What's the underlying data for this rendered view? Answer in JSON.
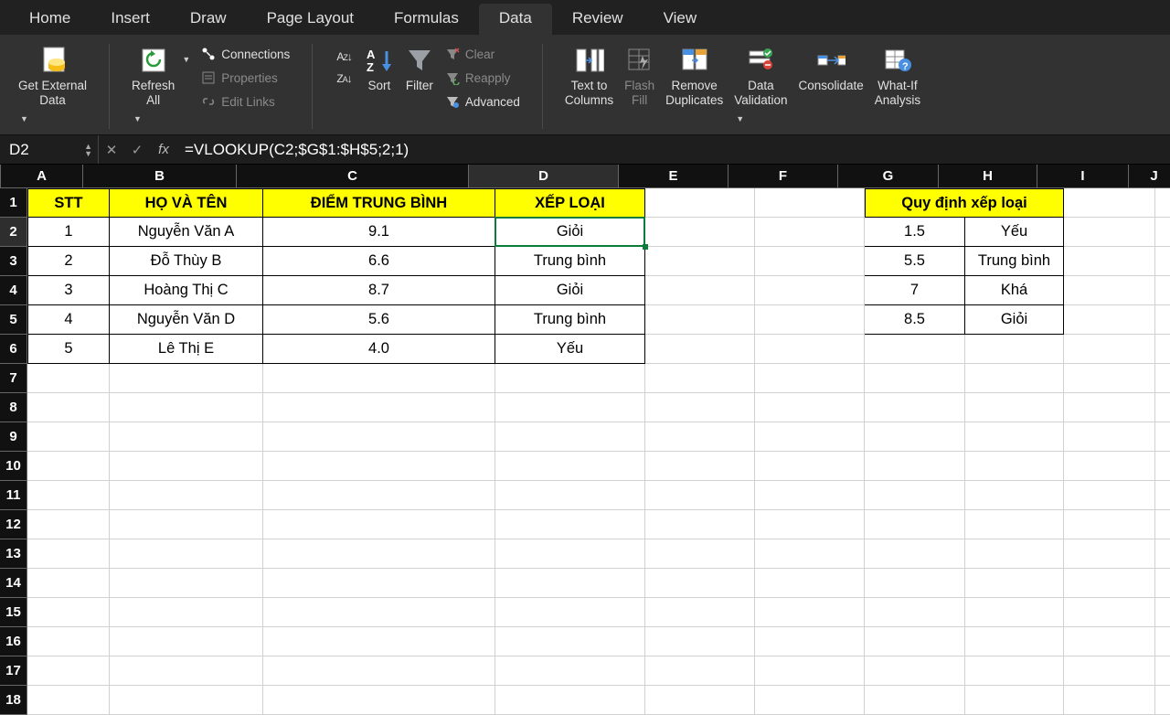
{
  "tabs": [
    "Home",
    "Insert",
    "Draw",
    "Page Layout",
    "Formulas",
    "Data",
    "Review",
    "View"
  ],
  "activeTab": "Data",
  "ribbon": {
    "getExternal": "Get External\nData",
    "refresh": "Refresh\nAll",
    "conn": "Connections",
    "prop": "Properties",
    "editLinks": "Edit Links",
    "sort": "Sort",
    "filter": "Filter",
    "clear": "Clear",
    "reapply": "Reapply",
    "advanced": "Advanced",
    "t2c": "Text to\nColumns",
    "flash": "Flash\nFill",
    "dup": "Remove\nDuplicates",
    "valid": "Data\nValidation",
    "consol": "Consolidate",
    "whatif": "What-If\nAnalysis"
  },
  "nameBox": "D2",
  "formula": "=VLOOKUP(C2;$G$1:$H$5;2;1)",
  "columns": [
    "A",
    "B",
    "C",
    "D",
    "E",
    "F",
    "G",
    "H",
    "I",
    "J"
  ],
  "selectedCol": "D",
  "selectedRow": 2,
  "rowCount": 18,
  "headers": {
    "stt": "STT",
    "name": "HỌ VÀ TÊN",
    "avg": "ĐIỂM TRUNG BÌNH",
    "rank": "XẾP LOẠI",
    "rule": "Quy định xếp loại"
  },
  "students": [
    {
      "stt": "1",
      "name": "Nguyễn Văn A",
      "avg": "9.1",
      "rank": "Giỏi"
    },
    {
      "stt": "2",
      "name": "Đỗ Thùy B",
      "avg": "6.6",
      "rank": "Trung bình"
    },
    {
      "stt": "3",
      "name": "Hoàng Thị C",
      "avg": "8.7",
      "rank": "Giỏi"
    },
    {
      "stt": "4",
      "name": "Nguyễn Văn D",
      "avg": "5.6",
      "rank": "Trung bình"
    },
    {
      "stt": "5",
      "name": "Lê Thị E",
      "avg": "4.0",
      "rank": "Yếu"
    }
  ],
  "rules": [
    {
      "min": "1.5",
      "label": "Yếu"
    },
    {
      "min": "5.5",
      "label": "Trung bình"
    },
    {
      "min": "7",
      "label": "Khá"
    },
    {
      "min": "8.5",
      "label": "Giỏi"
    }
  ]
}
